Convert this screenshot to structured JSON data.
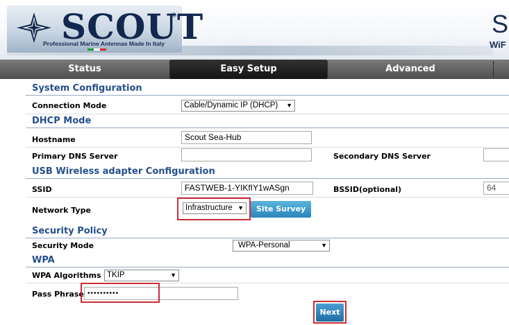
{
  "header": {
    "logo_text": "SCOUT",
    "logo_reg": "®",
    "tagline": "Professional Marine Antennas Made In Italy",
    "right_big": "S",
    "right_small": "WiF"
  },
  "tabs": [
    {
      "label": "Status",
      "active": false
    },
    {
      "label": "Easy Setup",
      "active": true
    },
    {
      "label": "Advanced",
      "active": false
    }
  ],
  "sections": {
    "system_config": "System Configuration",
    "dhcp_mode": "DHCP Mode",
    "usb_wireless": "USB Wireless adapter Configuration",
    "security_policy": "Security Policy",
    "wpa": "WPA"
  },
  "fields": {
    "connection_mode": {
      "label": "Connection Mode",
      "value": "Cable/Dynamic IP (DHCP)"
    },
    "hostname": {
      "label": "Hostname",
      "value": "Scout Sea-Hub"
    },
    "primary_dns": {
      "label": "Primary DNS Server",
      "value": ""
    },
    "secondary_dns": {
      "label": "Secondary DNS Server",
      "value": ""
    },
    "ssid": {
      "label": "SSID",
      "value": "FASTWEB-1-YIKfIY1wASgn"
    },
    "bssid": {
      "label": "BSSID(optional)",
      "value": "64"
    },
    "network_type": {
      "label": "Network Type",
      "value": "Infrastructure"
    },
    "security_mode": {
      "label": "Security Mode",
      "value": "WPA-Personal"
    },
    "wpa_algorithms": {
      "label": "WPA Algorithms",
      "value": "TKIP"
    },
    "pass_phrase": {
      "label": "Pass Phrase",
      "value": "••••••••••"
    }
  },
  "buttons": {
    "site_survey": "Site Survey",
    "next": "Next"
  },
  "colors": {
    "brand_navy": "#12284e",
    "section_blue": "#244f8c",
    "highlight_red": "#cc2b35",
    "button_blue": "#2a86bc",
    "flag_green": "#1e9c3a",
    "flag_white": "#ffffff",
    "flag_red": "#d22b2b"
  },
  "icons": {
    "logo": "compass-star-icon",
    "dropdown": "chevron-down-icon"
  }
}
